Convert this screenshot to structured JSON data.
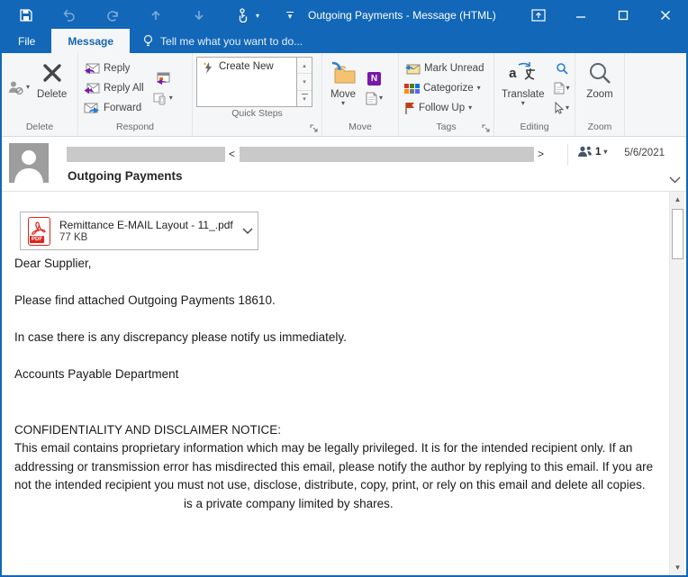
{
  "titlebar": {
    "title": "Outgoing Payments - Message (HTML)"
  },
  "tabs": {
    "file": "File",
    "message": "Message",
    "tell_me": "Tell me what you want to do..."
  },
  "ribbon": {
    "delete_group": {
      "label": "Delete",
      "delete": "Delete"
    },
    "respond_group": {
      "label": "Respond",
      "reply": "Reply",
      "reply_all": "Reply All",
      "forward": "Forward"
    },
    "quick_steps_group": {
      "label": "Quick Steps",
      "create_new": "Create New"
    },
    "move_group": {
      "label": "Move",
      "move": "Move"
    },
    "tags_group": {
      "label": "Tags",
      "mark_unread": "Mark Unread",
      "categorize": "Categorize",
      "follow_up": "Follow Up"
    },
    "editing_group": {
      "label": "Editing",
      "translate": "Translate"
    },
    "zoom_group": {
      "label": "Zoom",
      "zoom": "Zoom"
    }
  },
  "header": {
    "subject": "Outgoing Payments",
    "angle_open": "<",
    "angle_close": ">",
    "recipient_count": "1",
    "date": "5/6/2021"
  },
  "attachment": {
    "filename": "Remittance E-MAIL Layout - 11_.pdf",
    "size": "77 KB",
    "type_label": "PDF"
  },
  "body": {
    "greeting": "Dear Supplier,",
    "line1": "Please find attached Outgoing Payments 18610.",
    "line2": "In case there is any discrepancy please notify us immediately.",
    "signature": "Accounts Payable Department",
    "disclaimer_title": "CONFIDENTIALITY AND DISCLAIMER NOTICE:",
    "disclaimer_part1": "This email contains proprietary information which may be legally privileged. It is for the intended recipient only. If an addressing or transmission error has misdirected this email, please notify the author by replying to this email. If you are not the intended recipient you must not use, disclose, distribute, copy, print, or rely on this email and delete all copies.",
    "disclaimer_part2": "is a private company limited by shares."
  },
  "glyphs": {
    "caret_down": "▾",
    "gallery_up": "▴",
    "gallery_down": "▾",
    "gallery_more": "▾",
    "scroll_up": "▲",
    "scroll_down": "▼",
    "minimize": "–",
    "onenote_n": "N",
    "translate_a": "a"
  },
  "colors": {
    "titlebar_blue": "#1267B8",
    "active_tab_text": "#1566AD",
    "redaction_gray": "#C9C9C9",
    "pdf_red": "#E2231A",
    "flag_red": "#C0392B",
    "reply_purple": "#7719AA",
    "forward_blue": "#2B7CD3"
  }
}
